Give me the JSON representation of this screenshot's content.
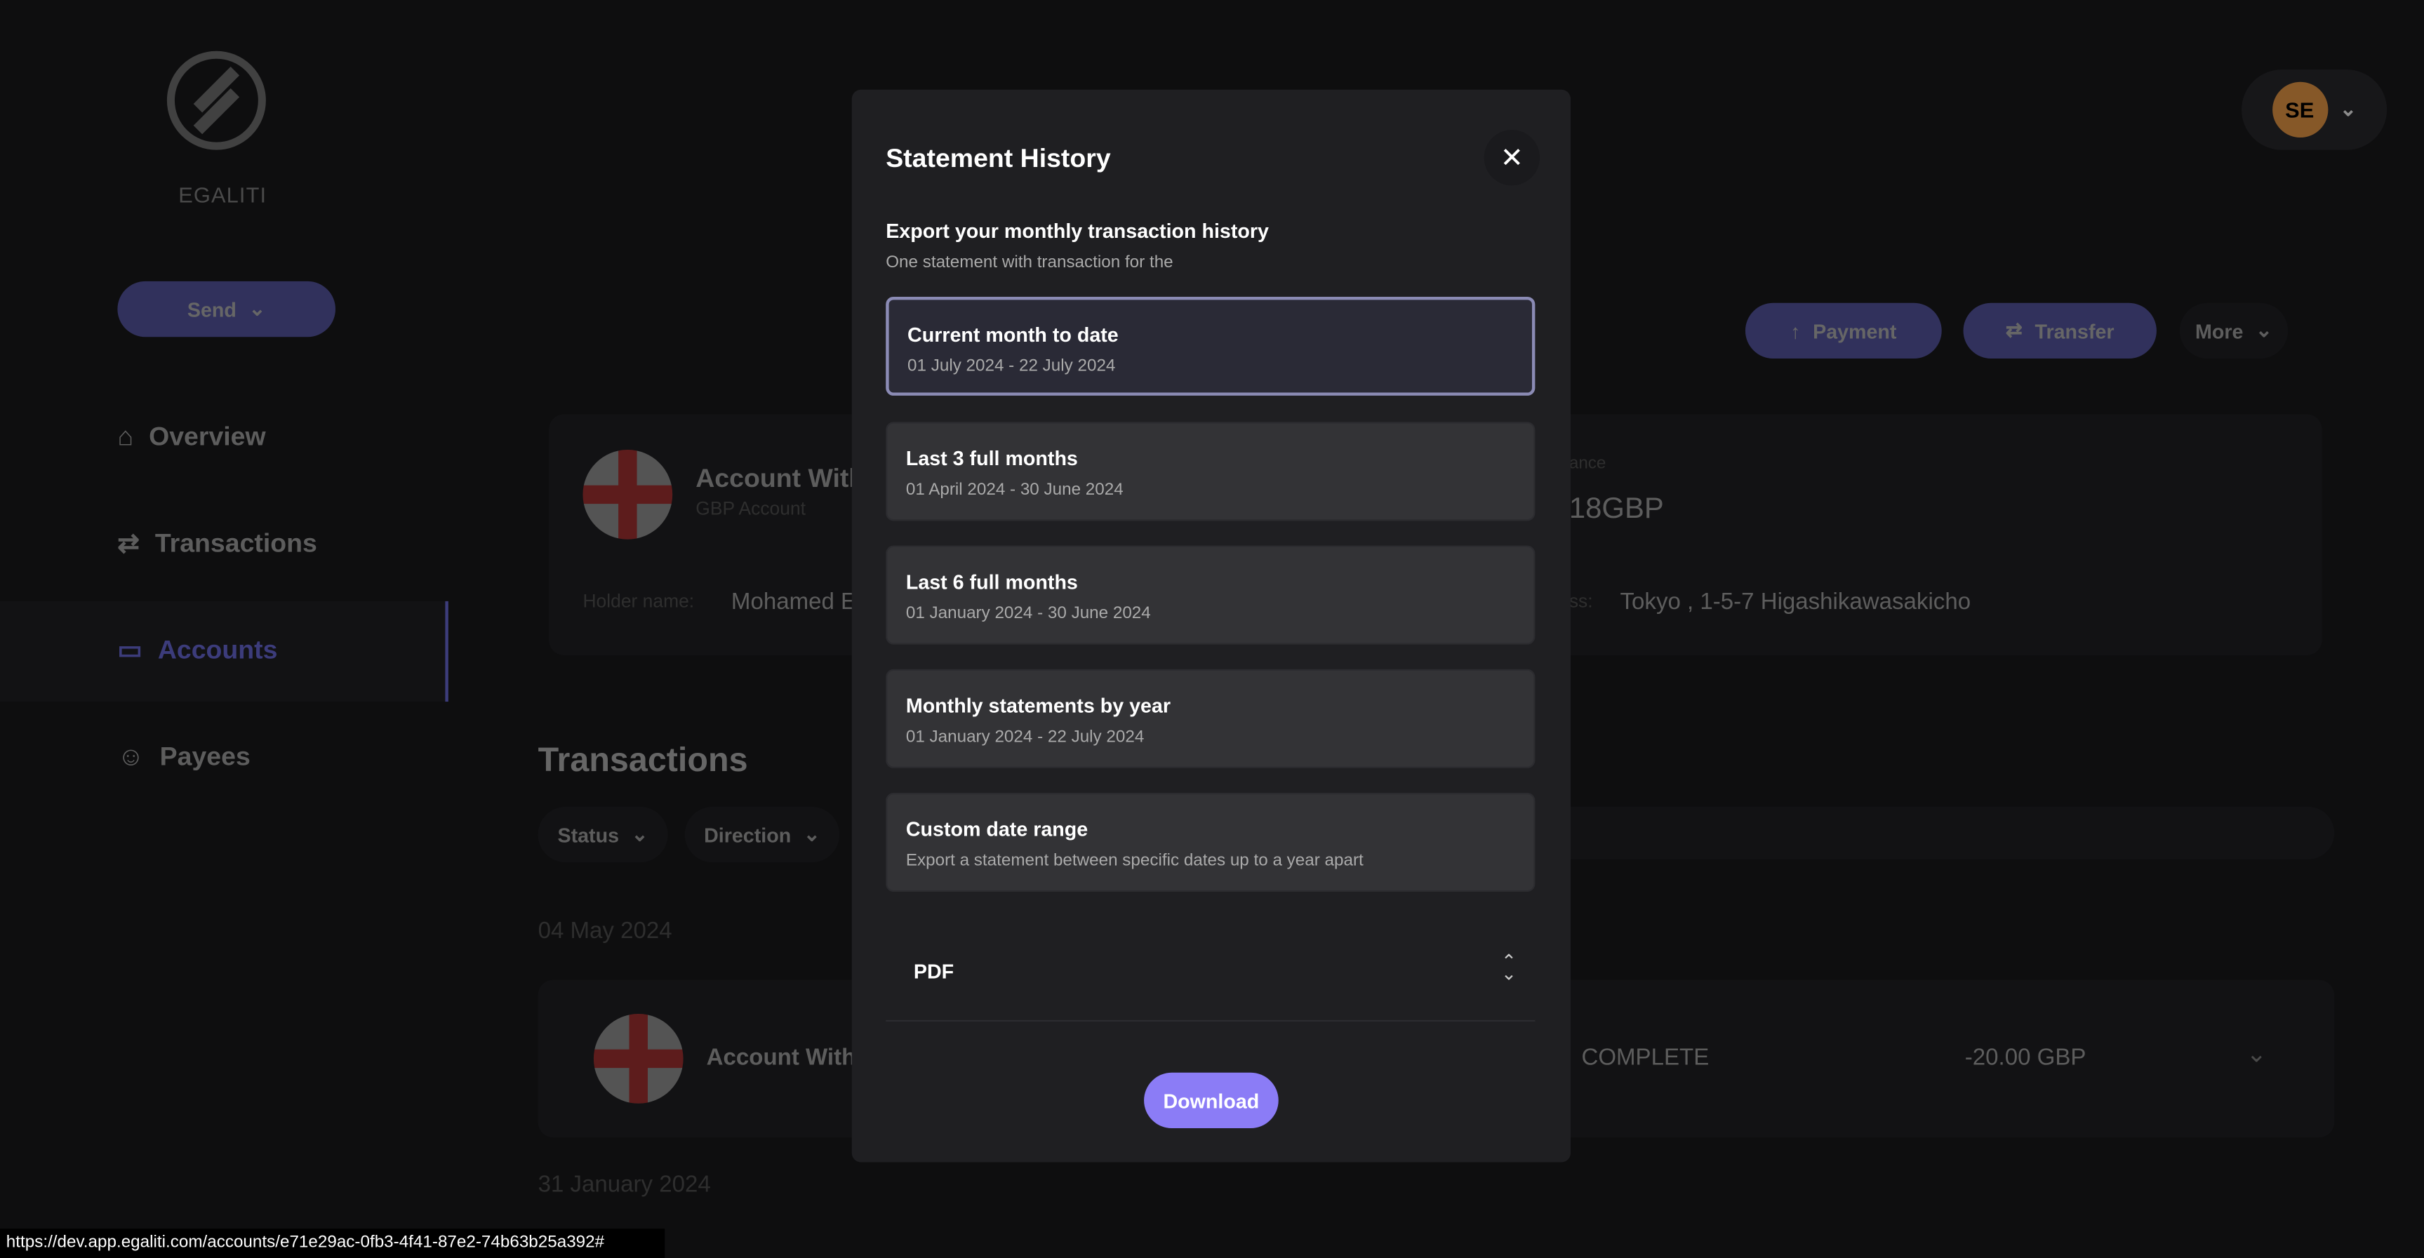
{
  "brand": "EGALITI",
  "sidebar": {
    "send": "Send",
    "items": [
      {
        "label": "Overview"
      },
      {
        "label": "Transactions"
      },
      {
        "label": "Accounts"
      },
      {
        "label": "Payees"
      }
    ]
  },
  "header": {
    "avatar": "SE",
    "avatar_color": "#f5a04a"
  },
  "actions": {
    "payment": "Payment",
    "transfer": "Transfer",
    "more": "More"
  },
  "account": {
    "name": "Account With",
    "type": "GBP Account",
    "balance_label": "ance",
    "balance": "18GBP",
    "holder_label": "Holder name:",
    "holder": "Mohamed E",
    "address_label": "ss:",
    "address": "Tokyo , 1-5-7 Higashikawasakicho"
  },
  "transactions": {
    "title": "Transactions",
    "filters": [
      "Status",
      "Direction"
    ],
    "groups": [
      {
        "date": "04 May 2024",
        "row": {
          "name": "Account With",
          "status": "COMPLETE",
          "amount": "-20.00 GBP"
        }
      },
      {
        "date": "31 January 2024"
      }
    ]
  },
  "modal": {
    "title": "Statement History",
    "heading": "Export your monthly transaction history",
    "subheading": "One statement with transaction for the",
    "options": [
      {
        "title": "Current month to date",
        "subtitle": "01 July 2024 - 22 July 2024",
        "selected": true
      },
      {
        "title": "Last 3 full months",
        "subtitle": "01 April 2024 - 30 June 2024"
      },
      {
        "title": "Last 6 full months",
        "subtitle": "01 January 2024 - 30 June 2024"
      },
      {
        "title": "Monthly statements by year",
        "subtitle": "01 January 2024 - 22 July 2024"
      },
      {
        "title": "Custom date range",
        "subtitle": "Export a statement between specific dates up to a year apart"
      }
    ],
    "format": "PDF",
    "download": "Download",
    "accent": "#8b7cf6"
  },
  "status_url": "https://dev.app.egaliti.com/accounts/e71e29ac-0fb3-4f41-87e2-74b63b25a392#"
}
